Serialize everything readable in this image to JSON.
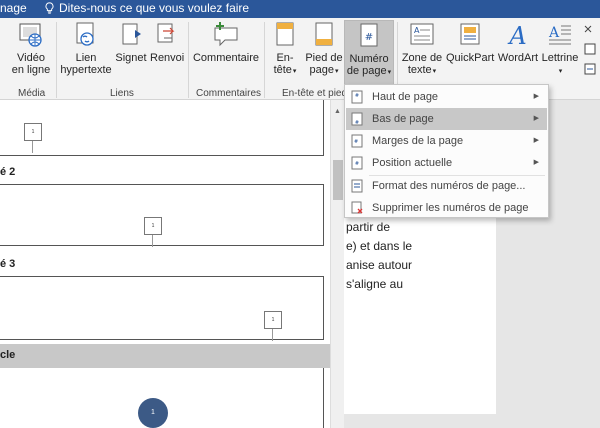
{
  "titlebar": {
    "tab_fragment": "nage",
    "tell_me": "Dites-nous ce que vous voulez faire"
  },
  "ribbon": {
    "buttons": {
      "video": [
        "Vidéo",
        "en ligne"
      ],
      "lien": [
        "Lien",
        "hypertexte"
      ],
      "signet": "Signet",
      "renvoi": "Renvoi",
      "commentaire": "Commentaire",
      "entete": [
        "En-",
        "tête"
      ],
      "pied": [
        "Pied de",
        "page"
      ],
      "numero": [
        "Numéro",
        "de page"
      ],
      "zone": [
        "Zone de",
        "texte"
      ],
      "quickpart": "QuickPart",
      "wordart": "WordArt",
      "lettrine": "Lettrine"
    },
    "groups": {
      "media": "Média",
      "liens": "Liens",
      "commentaires": "Commentaires",
      "entete_pied": "En-tête et pied"
    }
  },
  "menu": {
    "items": [
      {
        "label": "Haut de page"
      },
      {
        "label": "Bas de page"
      },
      {
        "label": "Marges de la page"
      },
      {
        "label": "Position actuelle"
      },
      {
        "label": "Format des numéros de page..."
      },
      {
        "label": "Supprimer les numéros de page"
      }
    ]
  },
  "gallery": {
    "labels": [
      "é 2",
      "é 3",
      "cle"
    ],
    "page_marks": [
      "1",
      "1",
      "1",
      "1"
    ]
  },
  "document": {
    "lines": [
      "partir de",
      "e) et dans le",
      "anise autour",
      "s'aligne au"
    ]
  },
  "colors": {
    "titlebar": "#2b579a",
    "highlight": "#c8c8c8",
    "page_circle": "#3c5a86"
  }
}
